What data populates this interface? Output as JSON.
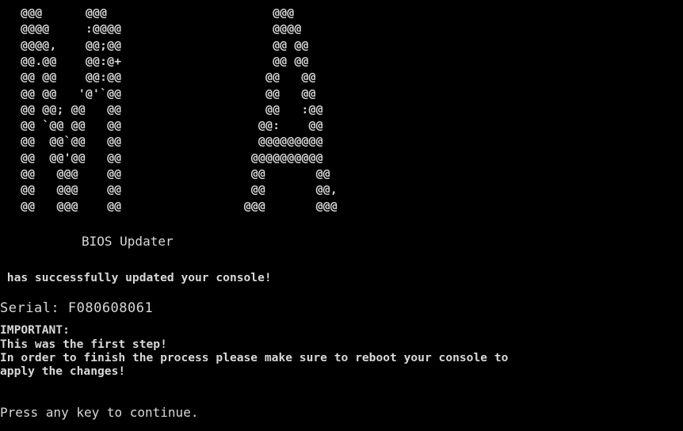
{
  "colors": {
    "background": "#000000",
    "text": "#d8d8d8"
  },
  "logo_lines": [
    "  @@@      @@@                       @@@",
    "  @@@@     :@@@@                     @@@@",
    "  @@@@,    @@;@@                     @@ @@",
    "  @@.@@    @@:@+                     @@ @@",
    "  @@ @@    @@:@@                    @@   @@",
    "  @@ @@   '@'`@@                    @@   @@",
    "  @@ @@; @@   @@                    @@   :@@",
    "  @@ `@@ @@   @@                   @@:    @@",
    "  @@  @@`@@   @@                   @@@@@@@@@",
    "  @@  @@'@@   @@                  @@@@@@@@@@",
    "  @@   @@@    @@                  @@       @@",
    "  @@   @@@    @@                  @@       @@,",
    "  @@   @@@    @@                 @@@       @@@"
  ],
  "updater_title": "BIOS Updater",
  "success_message": " has successfully updated your console!",
  "serial_line": "Serial: F080608061",
  "important_label": "IMPORTANT:",
  "step_line": "This was the first step!",
  "instruction_line_1": "In order to finish the process please make sure to reboot your console to",
  "instruction_line_2": "apply the changes!",
  "prompt": "Press any key to continue."
}
